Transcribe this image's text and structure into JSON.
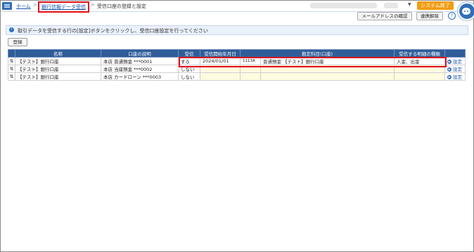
{
  "header": {
    "breadcrumb_home": "ホーム",
    "breadcrumb_sep": ">",
    "breadcrumb_section": "銀行信報データ受信",
    "breadcrumb_current": "受信口座の登録と設定",
    "system_end_label": "システム終了"
  },
  "toolbar": {
    "mail_check_label": "メールアドレスの確認",
    "link_release_label": "連携解除",
    "help_label": "?"
  },
  "info": {
    "icon": "i",
    "text": "取引データを受信する行の[設定]ボタンをクリックし、受信口座設定を行ってください"
  },
  "register_label": "登録",
  "table": {
    "headers": [
      "名称",
      "口座の説明",
      "受信",
      "受信開始年月日",
      "勘定科目(口座)",
      "受信する明細の種類"
    ],
    "sort_icon": "⇅",
    "setting_label": "設定",
    "rows": [
      {
        "name": "【テスト】銀行口座",
        "desc": "本店 普通預金 ***0001",
        "receive": "する",
        "start": "2024/01/01",
        "code": "1113A",
        "account": "普通預金 【テスト】銀行口座",
        "types": "入金、出金"
      },
      {
        "name": "【テスト】銀行口座",
        "desc": "本店 当座預金 ***0002",
        "receive": "しない",
        "start": "",
        "code": "",
        "account": "",
        "types": ""
      },
      {
        "name": "【テスト】銀行口座",
        "desc": "本店 カードローン ***0003",
        "receive": "しない",
        "start": "",
        "code": "",
        "account": "",
        "types": ""
      }
    ]
  },
  "colors": {
    "accent": "#2f5d99",
    "highlight": "#e0101a",
    "orange": "#f39c12"
  }
}
